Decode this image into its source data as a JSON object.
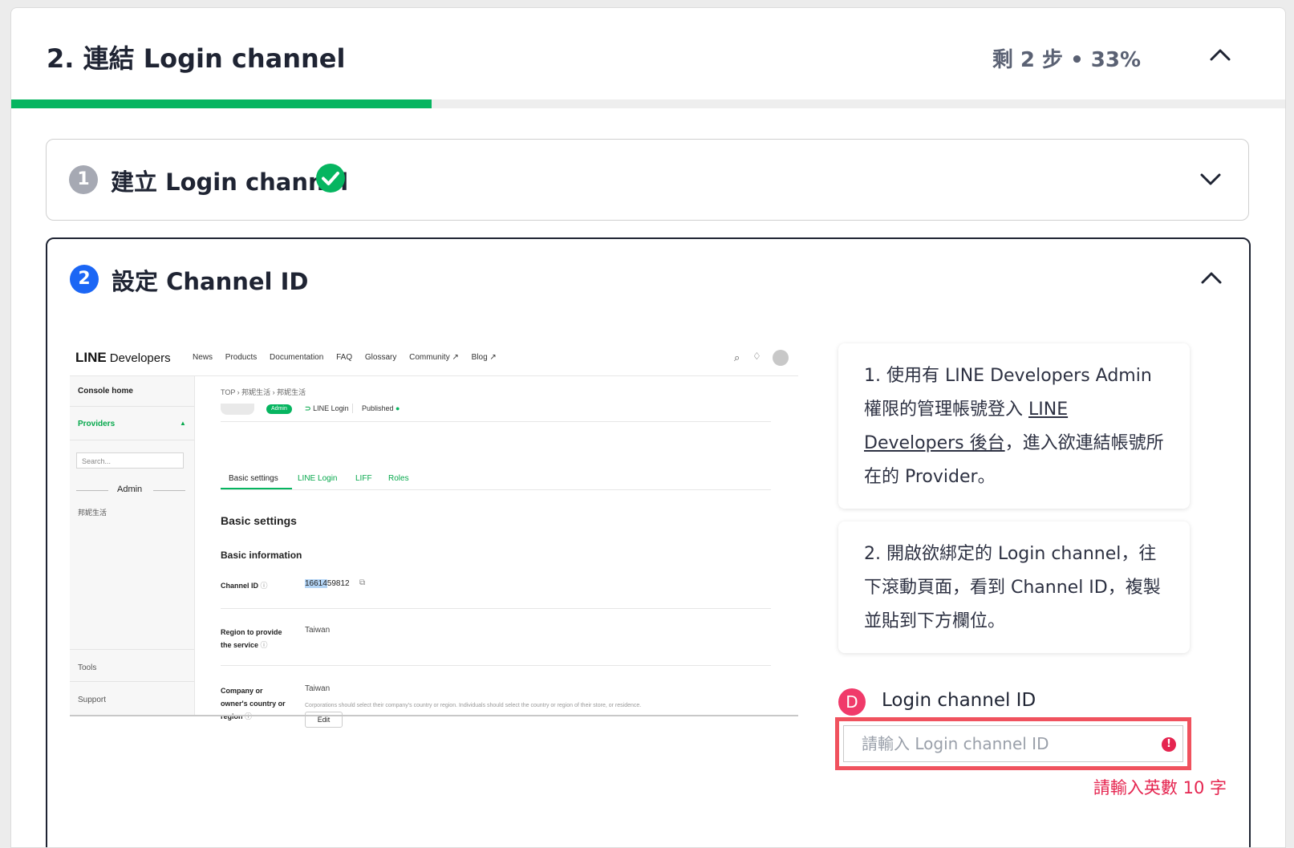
{
  "header": {
    "title": "2. 連結 Login channel",
    "progress_text": "剩 2 步 • 33%",
    "progress_fraction": 0.33
  },
  "step1": {
    "number": "1",
    "title": "建立 Login channel",
    "completed": true
  },
  "step2": {
    "number": "2",
    "title": "設定 Channel ID"
  },
  "screenshot": {
    "logo_line": "LINE",
    "logo_dev": "Developers",
    "nav": [
      "News",
      "Products",
      "Documentation",
      "FAQ",
      "Glossary",
      "Community ↗",
      "Blog ↗"
    ],
    "sidebar": {
      "console_home": "Console home",
      "providers": "Providers",
      "search_placeholder": "Search...",
      "admin": "Admin",
      "provider_name": "邦妮生活",
      "tools": "Tools",
      "support": "Support"
    },
    "breadcrumb": "TOP  ›  邦妮生活  ›  邦妮生活",
    "admin_badge": "Admin",
    "channel_type": "LINE Login",
    "status": "Published",
    "tabs": [
      "Basic settings",
      "LINE Login",
      "LIFF",
      "Roles"
    ],
    "section_title": "Basic settings",
    "subsection_title": "Basic information",
    "channel_id_label": "Channel ID",
    "channel_id_value": "1661459812",
    "region_label_1": "Region to provide",
    "region_label_2": "the service",
    "region_value": "Taiwan",
    "company_label_1": "Company or",
    "company_label_2": "owner's country or",
    "company_label_3": "region",
    "company_value": "Taiwan",
    "company_note": "Corporations should select their company's country or region. Individuals should select the country or region of their store, or residence.",
    "edit_button": "Edit"
  },
  "info1": {
    "text_a": "1. 使用有 LINE Developers Admin 權限的管理帳號登入 ",
    "link": "LINE Developers 後台",
    "text_b": "，進入欲連結帳號所在的 Provider。"
  },
  "info2": {
    "text": "2. 開啟欲綁定的 Login channel，往下滾動頁面，看到 Channel ID，複製並貼到下方欄位。"
  },
  "field": {
    "badge": "D",
    "label": "Login channel ID",
    "placeholder": "請輸入 Login channel ID",
    "alert_icon": "!",
    "error": "請輸入英數 10 字"
  },
  "colors": {
    "brand_green": "#06b560",
    "blue": "#1b66f5",
    "error": "#e5244f"
  }
}
